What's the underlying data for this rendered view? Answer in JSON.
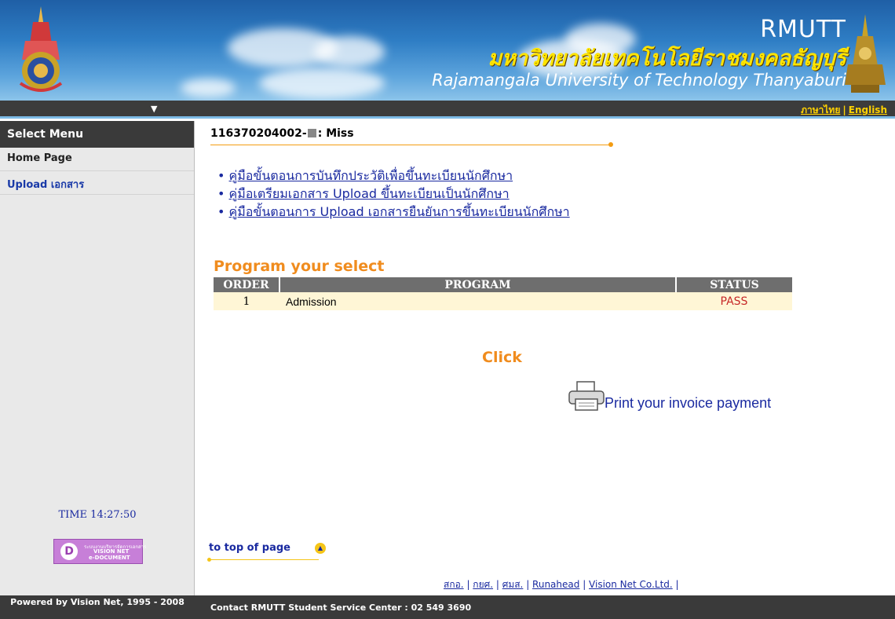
{
  "header": {
    "acronym": "RMUTT",
    "thai_name": "มหาวิทยาลัยเทคโนโลยีราชมงคลธัญบุรี",
    "english_name": "Rajamangala University of Technology Thanyaburi"
  },
  "nav": {
    "lang_thai": "ภาษาไทย",
    "lang_sep": "|",
    "lang_english": "English"
  },
  "sidebar": {
    "title": "Select Menu",
    "items": [
      {
        "label": "Home Page"
      },
      {
        "label": "Upload เอกสาร"
      }
    ],
    "time": "TIME 14:27:50",
    "badge": {
      "letter": "D",
      "line1": "ระบบงานบริหารจัดการเอกสาร",
      "line2": "VISION NET",
      "line3": "e-DOCUMENT"
    }
  },
  "main": {
    "student_id": "116370204002-",
    "student_title": ": Miss",
    "links": [
      "คู่มือขั้นตอนการบันทึกประวัติเพื่อขึ้นทะเบียนนักศึกษา",
      "คู่มือเตรียมเอกสาร Upload ขึ้นทะเบียนเป็นนักศึกษา",
      "คู่มือขั้นตอนการ Upload เอกสารยืนยันการขึ้นทะเบียนนักศึกษา"
    ],
    "program_title": "Program your select",
    "table": {
      "headers": [
        "ORDER",
        "PROGRAM",
        "STATUS"
      ],
      "rows": [
        {
          "order": "1",
          "program": "Admission",
          "status": "PASS"
        }
      ]
    },
    "click_label": "Click",
    "print_label": "Print your invoice payment",
    "to_top": "to top of page"
  },
  "footer": {
    "links": [
      "สกอ.",
      "กยศ.",
      "ศมส.",
      "Runahead",
      "Vision Net Co.Ltd."
    ],
    "powered": "Powered by Vision Net, 1995 - 2008",
    "contact": "Contact RMUTT Student Service Center : 02 549 3690"
  },
  "colors": {
    "accent_orange": "#f08c1e",
    "link_blue": "#1a2aa0",
    "status_red": "#c62828",
    "bar_dark": "#3a3a3a"
  }
}
